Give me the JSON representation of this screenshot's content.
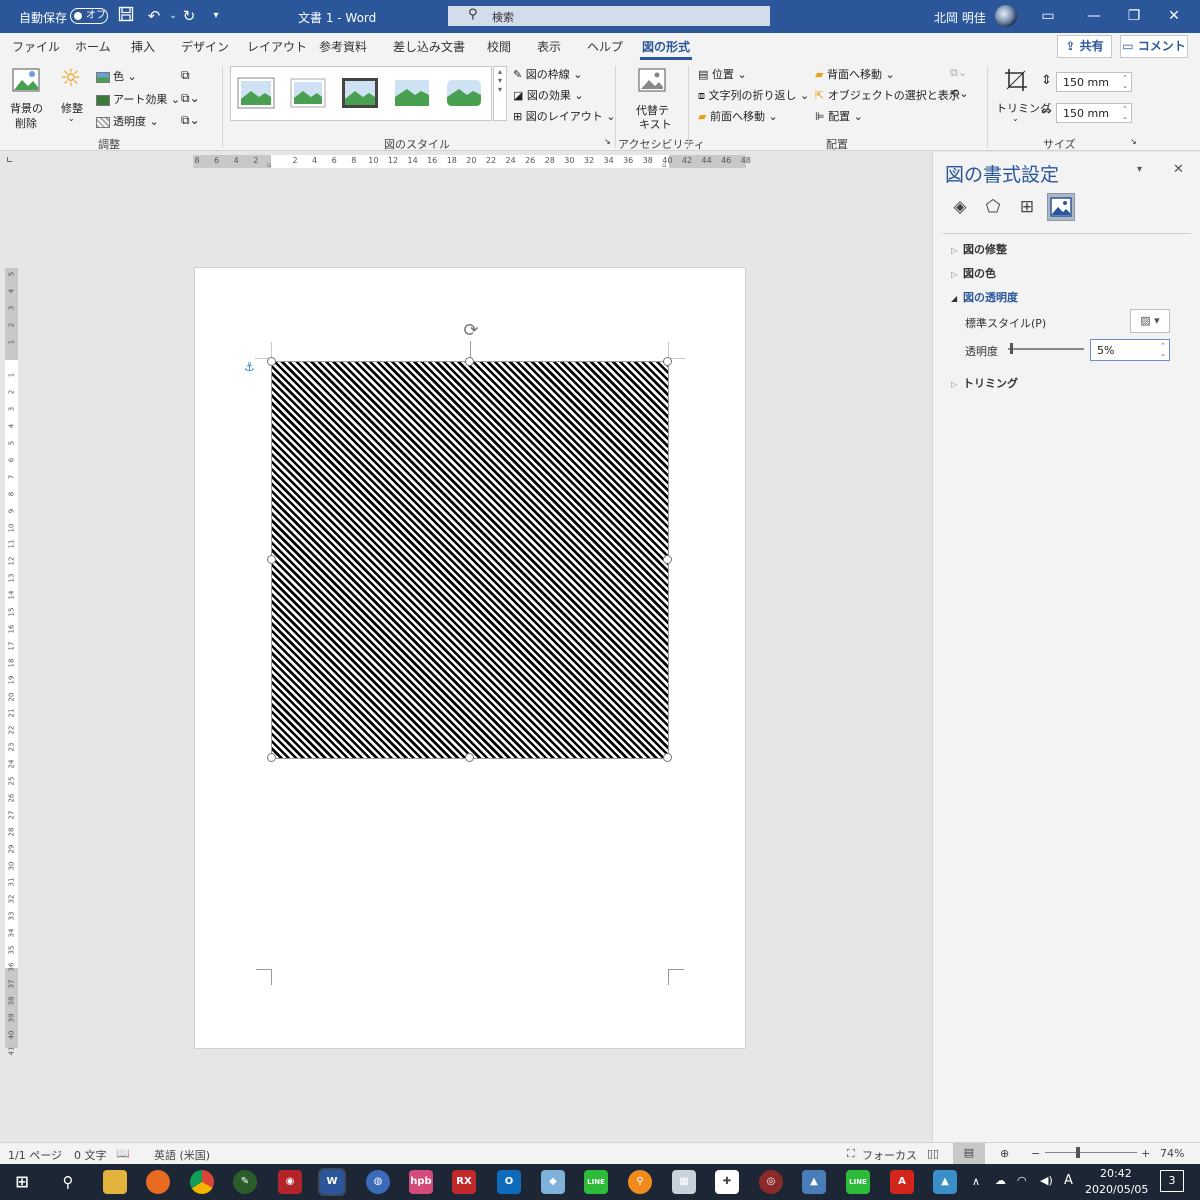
{
  "titlebar": {
    "autosave_label": "自動保存",
    "autosave_state": "オフ",
    "doc_title": "文書 1 - Word",
    "search_placeholder": "検索",
    "user_name": "北岡 明佳"
  },
  "menu": {
    "tabs": [
      "ファイル",
      "ホーム",
      "挿入",
      "デザイン",
      "レイアウト",
      "参考資料",
      "差し込み文書",
      "校閲",
      "表示",
      "ヘルプ",
      "図の形式"
    ],
    "active_tab": "図の形式",
    "share_label": "共有",
    "comment_label": "コメント"
  },
  "ribbon": {
    "adjust": {
      "remove_bg": [
        "背景の",
        "削除"
      ],
      "corrections": "修整",
      "color": "色",
      "art_effects": "アート効果",
      "transparency": "透明度",
      "group": "調整"
    },
    "styles": {
      "border": "図の枠線",
      "effects": "図の効果",
      "layout": "図のレイアウト",
      "group": "図のスタイル"
    },
    "accessibility": {
      "alt_text": [
        "代替テ",
        "キスト"
      ],
      "group": "アクセシビリティ"
    },
    "arrange": {
      "position": "位置",
      "wrap_text": "文字列の折り返し",
      "bring_forward": "前面へ移動",
      "send_backward": "背面へ移動",
      "selection_pane": "オブジェクトの選択と表示",
      "align": "配置",
      "group": "配置"
    },
    "size": {
      "crop": "トリミング",
      "height": "150 mm",
      "width": "150 mm",
      "group": "サイズ"
    }
  },
  "ruler": {
    "h_ticks": [
      "8",
      "6",
      "4",
      "2",
      "",
      "2",
      "4",
      "6",
      "8",
      "10",
      "12",
      "14",
      "16",
      "18",
      "20",
      "22",
      "24",
      "26",
      "28",
      "30",
      "32",
      "34",
      "36",
      "38",
      "40",
      "42",
      "44",
      "46",
      "48"
    ],
    "v_ticks": [
      "5",
      "4",
      "3",
      "2",
      "1",
      "",
      "1",
      "2",
      "3",
      "4",
      "5",
      "6",
      "7",
      "8",
      "9",
      "10",
      "11",
      "12",
      "13",
      "14",
      "15",
      "16",
      "17",
      "18",
      "19",
      "20",
      "21",
      "22",
      "23",
      "24",
      "25",
      "26",
      "27",
      "28",
      "29",
      "30",
      "31",
      "32",
      "33",
      "34",
      "35",
      "36",
      "37",
      "38",
      "39",
      "40",
      "41"
    ]
  },
  "pane": {
    "title": "図の書式設定",
    "sections": {
      "corrections": "図の修整",
      "color": "図の色",
      "transparency": "図の透明度",
      "crop": "トリミング"
    },
    "preset_label": "標準スタイル(P)",
    "transparency_label": "透明度",
    "transparency_value": "5%",
    "transparency_level_percent": 5
  },
  "statusbar": {
    "page": "1/1 ページ",
    "words": "0 文字",
    "language": "英語 (米国)",
    "focus": "フォーカス",
    "zoom": "74%"
  },
  "taskbar": {
    "apps": [
      "",
      "",
      "",
      "",
      "",
      "",
      "W",
      "",
      "hpb",
      "RX",
      "",
      "",
      "LINE",
      "",
      "",
      "",
      "",
      "",
      "LINE",
      "",
      ""
    ],
    "time": "20:42",
    "date": "2020/05/05",
    "notifications": "3",
    "ime": "A"
  },
  "colors": {
    "accent": "#2b579a",
    "ribbon_bg": "#f3f3f3",
    "canvas_bg": "#e6e6e6",
    "taskbar_bg": "#1c2634"
  }
}
